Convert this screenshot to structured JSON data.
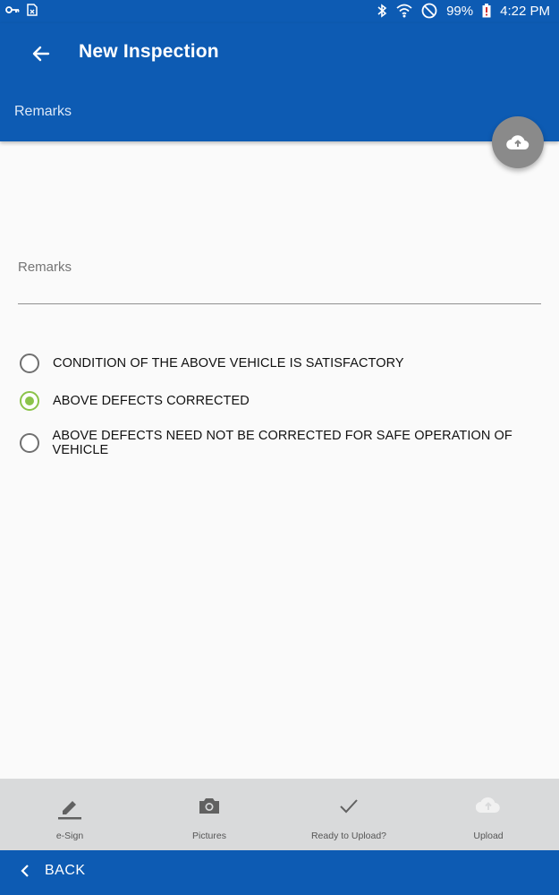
{
  "status_bar": {
    "battery": "99%",
    "time": "4:22 PM",
    "icons": [
      "key-icon",
      "sim-icon",
      "bluetooth-icon",
      "wifi-icon",
      "do-not-disturb-icon",
      "battery-icon"
    ]
  },
  "header": {
    "title": "New Inspection",
    "section": "Remarks"
  },
  "remarks": {
    "label": "Remarks",
    "value": ""
  },
  "options": [
    {
      "label": "CONDITION OF THE ABOVE VEHICLE IS SATISFACTORY",
      "checked": false
    },
    {
      "label": "ABOVE DEFECTS CORRECTED",
      "checked": true
    },
    {
      "label": "ABOVE DEFECTS NEED NOT BE CORRECTED FOR SAFE OPERATION OF VEHICLE",
      "checked": false
    }
  ],
  "toolbar": {
    "esign": "e-Sign",
    "pictures": "Pictures",
    "ready": "Ready to Upload?",
    "upload": "Upload"
  },
  "footer": {
    "back": "BACK"
  },
  "colors": {
    "primary": "#0d5bb3",
    "accent": "#8bc34a",
    "fab": "#8a8a8a"
  }
}
